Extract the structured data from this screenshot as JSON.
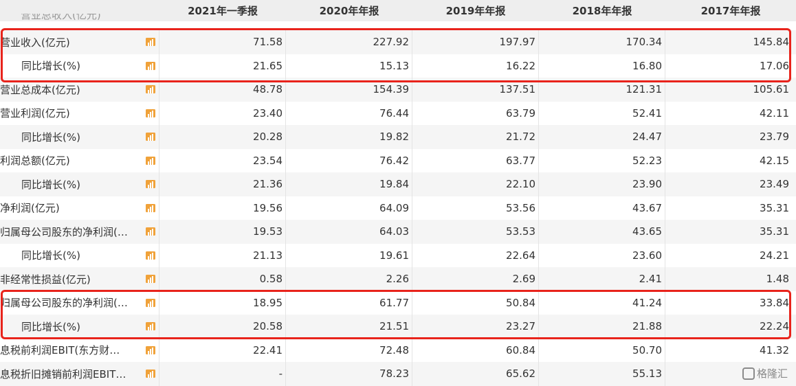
{
  "header": {
    "partial_label": "营业总收入(亿元)",
    "columns": [
      "2021年一季报",
      "2020年年报",
      "2019年年报",
      "2018年年报",
      "2017年年报"
    ]
  },
  "rows": [
    {
      "label": "营业收入(亿元)",
      "indent": false,
      "values": [
        "71.58",
        "227.92",
        "197.97",
        "170.34",
        "145.84"
      ]
    },
    {
      "label": "同比增长(%)",
      "indent": true,
      "values": [
        "21.65",
        "15.13",
        "16.22",
        "16.80",
        "17.06"
      ]
    },
    {
      "label": "营业总成本(亿元)",
      "indent": false,
      "values": [
        "48.78",
        "154.39",
        "137.51",
        "121.31",
        "105.61"
      ]
    },
    {
      "label": "营业利润(亿元)",
      "indent": false,
      "values": [
        "23.40",
        "76.44",
        "63.79",
        "52.41",
        "42.11"
      ]
    },
    {
      "label": "同比增长(%)",
      "indent": true,
      "values": [
        "20.28",
        "19.82",
        "21.72",
        "24.47",
        "23.79"
      ]
    },
    {
      "label": "利润总额(亿元)",
      "indent": false,
      "values": [
        "23.54",
        "76.42",
        "63.77",
        "52.23",
        "42.15"
      ]
    },
    {
      "label": "同比增长(%)",
      "indent": true,
      "values": [
        "21.36",
        "19.84",
        "22.10",
        "23.90",
        "23.49"
      ]
    },
    {
      "label": "净利润(亿元)",
      "indent": false,
      "values": [
        "19.56",
        "64.09",
        "53.56",
        "43.67",
        "35.31"
      ]
    },
    {
      "label": "归属母公司股东的净利润(…",
      "indent": false,
      "values": [
        "19.53",
        "64.03",
        "53.53",
        "43.65",
        "35.31"
      ]
    },
    {
      "label": "同比增长(%)",
      "indent": true,
      "values": [
        "21.13",
        "19.61",
        "22.64",
        "23.60",
        "24.21"
      ]
    },
    {
      "label": "非经常性损益(亿元)",
      "indent": false,
      "values": [
        "0.58",
        "2.26",
        "2.69",
        "2.41",
        "1.48"
      ]
    },
    {
      "label": "归属母公司股东的净利润(…",
      "indent": false,
      "values": [
        "18.95",
        "61.77",
        "50.84",
        "41.24",
        "33.84"
      ]
    },
    {
      "label": "同比增长(%)",
      "indent": true,
      "values": [
        "20.58",
        "21.51",
        "23.27",
        "21.88",
        "22.24"
      ]
    },
    {
      "label": "息税前利润EBIT(东方财…",
      "indent": false,
      "values": [
        "22.41",
        "72.48",
        "60.84",
        "50.70",
        "41.32"
      ]
    },
    {
      "label": "息税折旧摊销前利润EBIT…",
      "indent": false,
      "values": [
        "-",
        "78.23",
        "65.62",
        "55.13",
        ""
      ]
    }
  ],
  "watermark": "格隆汇",
  "colors": {
    "highlight": "#e8231b",
    "icon": "#f0a23a",
    "row_alt": "#f5f5f5"
  },
  "icons": {
    "row_chart": "bar-chart-icon"
  }
}
